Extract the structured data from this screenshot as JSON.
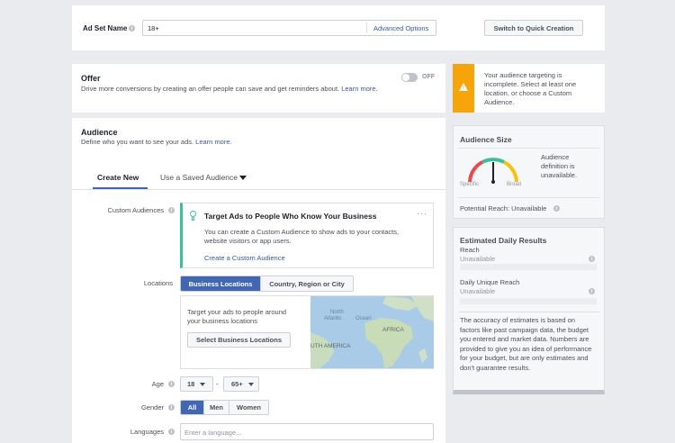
{
  "adset": {
    "label": "Ad Set Name",
    "name_value": "18+",
    "advanced_link": "Advanced Options",
    "switch_button": "Switch to Quick Creation"
  },
  "offer": {
    "title": "Offer",
    "description": "Drive more conversions by creating an offer people can save and get reminders about.",
    "learn_more": "Learn more.",
    "toggle_state": "OFF"
  },
  "warning": {
    "text": "Your audience targeting is incomplete. Select at least one location, or choose a Custom Audience.",
    "accent_color": "#f7a30a"
  },
  "audience": {
    "title": "Audience",
    "description": "Define who you want to see your ads.",
    "learn_more": "Learn more.",
    "tabs": [
      {
        "label": "Create New",
        "active": true
      },
      {
        "label": "Use a Saved Audience",
        "active": false
      }
    ],
    "custom_audiences": {
      "label": "Custom Audiences",
      "card_title": "Target Ads to People Who Know Your Business",
      "card_body": "You can create a Custom Audience to show ads to your contacts, website visitors or app users.",
      "card_link": "Create a Custom Audience",
      "more_icon": "ellipsis-icon"
    },
    "locations": {
      "label": "Locations",
      "options": [
        "Business Locations",
        "Country, Region or City"
      ],
      "selected": "Business Locations",
      "prompt": "Target your ads to people around your business locations",
      "select_button": "Select Business Locations",
      "map_labels": [
        "North",
        "Atlantic",
        "Ocean",
        "AFRICA",
        "UTH AMERICA"
      ]
    },
    "age": {
      "label": "Age",
      "min": "18",
      "separator": "-",
      "max": "65+"
    },
    "gender": {
      "label": "Gender",
      "options": [
        "All",
        "Men",
        "Women"
      ],
      "selected": "All"
    },
    "languages": {
      "label": "Languages",
      "placeholder": "Enter a language..."
    }
  },
  "audience_size": {
    "title": "Audience Size",
    "gauge_left": "Specific",
    "gauge_right": "Broad",
    "status": "Audience definition is unavailable.",
    "potential_reach": "Potential Reach: Unavailable"
  },
  "daily_results": {
    "title": "Estimated Daily Results",
    "reach_label": "Reach",
    "reach_value": "Unavailable",
    "unique_reach_label": "Daily Unique Reach",
    "unique_reach_value": "Unavailable",
    "note": "The accuracy of estimates is based on factors like past campaign data, the budget you entered and market data. Numbers are provided to give you an idea of performance for your budget, but are only estimates and don't guarantee results."
  },
  "colors": {
    "brand": "#4267b2",
    "link": "#365899",
    "teal_accent": "#3bbf9b",
    "warning": "#f7a30a"
  }
}
